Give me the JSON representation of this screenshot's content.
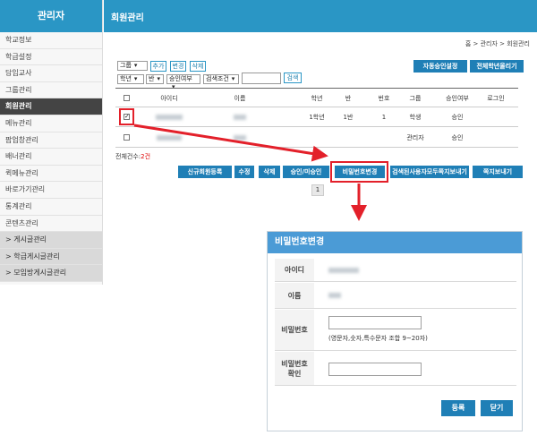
{
  "sidebar": {
    "title": "관리자",
    "items": [
      {
        "label": "학교정보"
      },
      {
        "label": "학급설정"
      },
      {
        "label": "담임교사"
      },
      {
        "label": "그룹관리"
      },
      {
        "label": "회원관리"
      },
      {
        "label": "메뉴관리"
      },
      {
        "label": "팝업창관리"
      },
      {
        "label": "배너관리"
      },
      {
        "label": "퀵메뉴관리"
      },
      {
        "label": "바로가기관리"
      },
      {
        "label": "통계관리"
      },
      {
        "label": "콘텐츠관리"
      },
      {
        "label": "> 게시글관리"
      },
      {
        "label": "> 학급게시글관리"
      },
      {
        "label": "> 모임방게시글관리"
      }
    ],
    "active_index": 4
  },
  "header": {
    "title": "회원관리"
  },
  "breadcrumb": "홈 > 관리자 > 회원관리",
  "toolbar": {
    "group_select": "그룹",
    "add_label": "추가",
    "change_label": "변경",
    "delete_label": "삭제",
    "auto_approve_label": "자동승인설정",
    "promote_all_label": "전체학년올리기",
    "grade_select": "학년",
    "class_select": "반",
    "approval_select": "승인여부",
    "search_cond_select": "검색조건",
    "search_input_value": "",
    "search_label": "검색"
  },
  "table": {
    "headers": [
      "",
      "아이디",
      "이름",
      "학년",
      "반",
      "번호",
      "그룹",
      "승인여부",
      "로그인"
    ],
    "rows": [
      {
        "checked": true,
        "grade": "1학년",
        "class": "1반",
        "number": "1",
        "group": "학생",
        "approval": "승인",
        "login": ""
      },
      {
        "checked": false,
        "grade": "",
        "class": "",
        "number": "",
        "group": "관리자",
        "approval": "승인",
        "login": ""
      }
    ]
  },
  "total": {
    "label": "전체건수:",
    "count": "2건"
  },
  "actions": {
    "new_member": "신규회원등록",
    "edit": "수정",
    "delete": "삭제",
    "approve": "승인/미승인",
    "change_password": "비밀번호변경",
    "send_note_all": "검색된사용자모두쪽지보내기",
    "send_note": "쪽지보내기"
  },
  "pagination": {
    "current": "1"
  },
  "dialog": {
    "title": "비밀번호변경",
    "id_label": "아이디",
    "name_label": "이름",
    "password_label": "비밀번호",
    "password_hint": "(영문자,숫자,특수문자 조합 9~20자)",
    "confirm_label_1": "비밀번호",
    "confirm_label_2": "확인",
    "register": "등록",
    "close": "닫기"
  },
  "colors": {
    "brand": "#2a96c5",
    "button": "#1f7fb6",
    "highlight": "#e3202a"
  }
}
